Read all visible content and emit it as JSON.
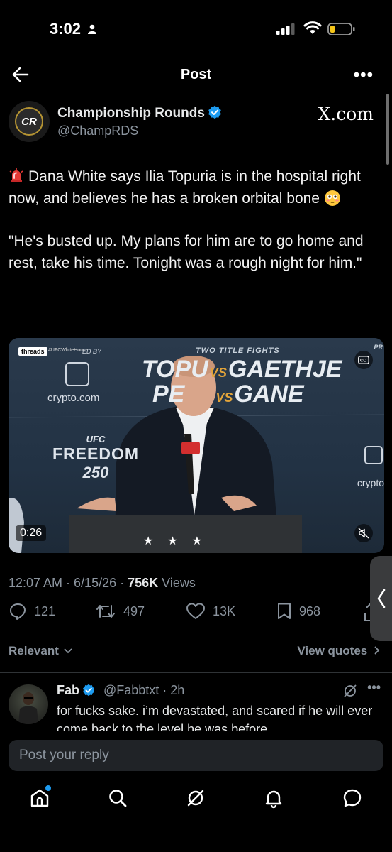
{
  "status_bar": {
    "time": "3:02"
  },
  "header": {
    "title": "Post"
  },
  "author": {
    "avatar_text": "CR",
    "display_name": "Championship Rounds",
    "handle": "@ChampRDS",
    "source_label": "X.com"
  },
  "tweet": {
    "paragraph1": "Dana White says Ilia Topuria is in the hospital right now, and believes he has a broken orbital bone",
    "paragraph2": "\"He's busted up. My plans for him are to go home and rest, take his time. Tonight was a rough night for him.\""
  },
  "media": {
    "threads_tag": "threads",
    "threads_handle": "#UFCWhiteHouse",
    "sponsor_by": "ED BY",
    "two_title_fights": "TWO TITLE FIGHTS",
    "fight1_left": "TOPU",
    "fight1_right": "GAETHJE",
    "fight2_left": "PE",
    "fight2_right": "GANE",
    "vs": "VS",
    "sponsor": "crypto.com",
    "event_small": "UFC",
    "event_big": "FREEDOM",
    "event_number": "250",
    "sponsor_right": "crypto",
    "pr_text": "PR",
    "duration": "0:26"
  },
  "meta": {
    "timestamp": "12:07 AM · 6/15/26 · ",
    "views_count": "756K",
    "views_label": " Views"
  },
  "actions": {
    "replies": "121",
    "reposts": "497",
    "likes": "13K",
    "bookmarks": "968"
  },
  "filters": {
    "relevant": "Relevant",
    "view_quotes": "View quotes"
  },
  "reply": {
    "name": "Fab",
    "handle_time": "@Fabbtxt · 2h",
    "text": "for fucks sake. i’m devastated, and scared if he will ever come back to the level he was before"
  },
  "compose": {
    "placeholder": "Post your reply"
  },
  "colors": {
    "accent": "#1d9bf0",
    "background": "#000000",
    "secondary_text": "#8b949e"
  }
}
